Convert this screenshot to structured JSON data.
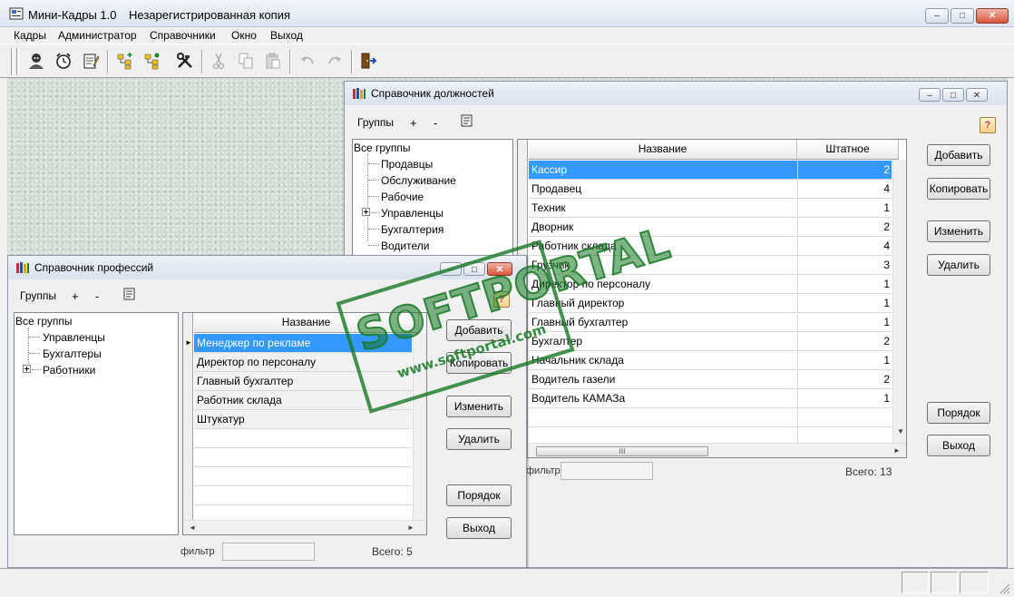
{
  "app": {
    "title": "Мини-Кадры 1.0",
    "subtitle": "Незарегистрированная копия",
    "window_buttons": {
      "minimize": "–",
      "maximize": "□",
      "close": "✕"
    }
  },
  "menu": [
    "Кадры",
    "Администратор",
    "Справочники",
    "Окно",
    "Выход"
  ],
  "toolbar": {
    "buttons": [
      "employee-icon",
      "alarm-clock-icon",
      "notepad-icon",
      "tree-add-icon",
      "tree-edit-icon",
      "tools-icon",
      "cut-icon",
      "copy-icon",
      "paste-icon",
      "undo-icon",
      "redo-icon",
      "exit-door-icon"
    ]
  },
  "positions_window": {
    "title": "Справочник должностей",
    "groups_label": "Группы",
    "add_group": "+",
    "remove_group": "-",
    "help": "?",
    "tree": {
      "root": "Все группы",
      "items": [
        "Продавцы",
        "Обслуживание",
        "Рабочие",
        "Управленцы",
        "Бухгалтерия",
        "Водители"
      ]
    },
    "columns": [
      "Название",
      "Штатное расписание"
    ],
    "rows": [
      {
        "name": "Кассир",
        "count": "2"
      },
      {
        "name": "Продавец",
        "count": "4"
      },
      {
        "name": "Техник",
        "count": "1"
      },
      {
        "name": "Дворник",
        "count": "2"
      },
      {
        "name": "Работник склада",
        "count": "4"
      },
      {
        "name": "Грузчик",
        "count": "3"
      },
      {
        "name": "Директор по персоналу",
        "count": "1"
      },
      {
        "name": "Главный директор",
        "count": "1"
      },
      {
        "name": "Главный бухгалтер",
        "count": "1"
      },
      {
        "name": "Бухгалтер",
        "count": "2"
      },
      {
        "name": "Начальник склада",
        "count": "1"
      },
      {
        "name": "Водитель газели",
        "count": "2"
      },
      {
        "name": "Водитель КАМАЗа",
        "count": "1"
      }
    ],
    "buttons": {
      "add": "Добавить",
      "copy": "Копировать",
      "edit": "Изменить",
      "delete": "Удалить",
      "order": "Порядок",
      "exit": "Выход"
    },
    "filter_label": "фильтр",
    "filter_value": "",
    "total": "Всего: 13",
    "scroll_thumb": "III"
  },
  "professions_window": {
    "title": "Справочник профессий",
    "groups_label": "Группы",
    "add_group": "+",
    "remove_group": "-",
    "help": "?",
    "tree": {
      "root": "Все группы",
      "items": [
        "Управленцы",
        "Бухгалтеры",
        "Работники"
      ]
    },
    "columns": [
      "Название"
    ],
    "rows": [
      "Менеджер по рекламе",
      "Директор по персоналу",
      "Главный бухгалтер",
      "Работник склада",
      "Штукатур"
    ],
    "buttons": {
      "add": "Добавить",
      "copy": "Копировать",
      "edit": "Изменить",
      "delete": "Удалить",
      "order": "Порядок",
      "exit": "Выход"
    },
    "filter_label": "фильтр",
    "filter_value": "",
    "total": "Всего: 5"
  },
  "watermark": {
    "brand": "SOFTPORTAL",
    "url": "www.softportal.com"
  },
  "colors": {
    "selection": "#3399ff",
    "watermark": "#187824",
    "desktop": "#d3dcd2"
  }
}
